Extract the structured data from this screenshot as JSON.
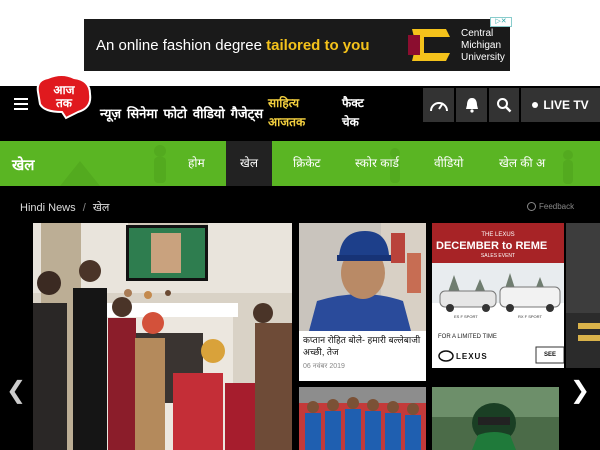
{
  "ad": {
    "text_prefix": "An online fashion degree",
    "text_highlight": "tailored to you",
    "university_line1": "Central",
    "university_line2": "Michigan",
    "university_line3": "University",
    "colors": {
      "background": "#1a1a1a",
      "highlight": "#f4c21b"
    }
  },
  "header": {
    "logo_icon": "aaj-tak-logo",
    "nav": [
      "न्यूज़",
      "सिनेमा",
      "फोटो",
      "वीडियो",
      "गैजेट्स"
    ],
    "sahitya_line1": "साहित्य",
    "sahitya_line2": "आजतक",
    "fact_line1": "फैक्ट",
    "fact_line2": "चेक",
    "live_label": "LIVE TV",
    "icons": [
      "speedometer-icon",
      "bell-icon",
      "search-icon"
    ]
  },
  "section": {
    "title": "खेल",
    "items": [
      "होम",
      "खेल",
      "क्रिकेट",
      "स्कोर कार्ड",
      "वीडियो",
      "खेल की अ"
    ],
    "active_index": 1,
    "colors": {
      "bar": "#5ab523",
      "active": "#222222"
    }
  },
  "breadcrumb": {
    "home": "Hindi News",
    "separator": "/",
    "current": "खेल"
  },
  "feedback_label": "Feedback",
  "cards": [
    {
      "title": "कप्तान रोहित बोले- हमारी बल्लेबाजी अच्छी, तेज",
      "date": "06 नवंबर 2019"
    }
  ],
  "sponsor": {
    "line1": "THE LEXUS",
    "line2": "DECEMBER to REME",
    "line3": "SALES EVENT",
    "car1": "ES F SPORT",
    "car2": "RX F SPORT",
    "footer": "FOR A LIMITED TIME",
    "brand": "LEXUS",
    "cta": "SEE"
  },
  "slider": {
    "prev_icon": "chevron-left-icon",
    "next_icon": "chevron-right-icon"
  }
}
